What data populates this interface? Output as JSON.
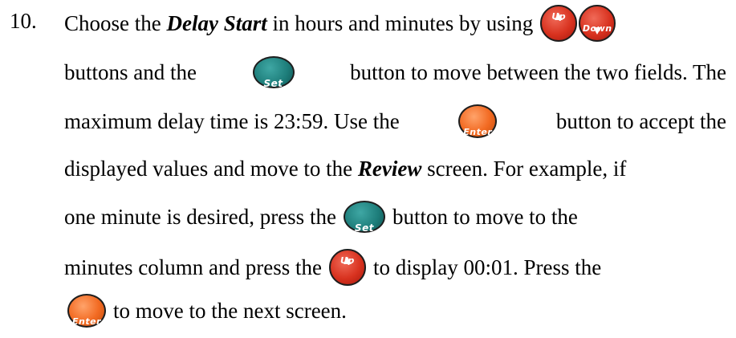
{
  "step": {
    "number": "10."
  },
  "text": {
    "l1_a": "Choose the",
    "l1_term": "Delay Start",
    "l1_b": "in hours and minutes by using",
    "l2_a": "buttons and the",
    "l2_b": "button to move between the two fields. The",
    "l3_a": "maximum delay time is 23:59. Use the",
    "l3_b": "button to accept the",
    "l4_a": "displayed values and move to the",
    "l4_term": "Review",
    "l4_b": "screen. For example, if",
    "l5_a": "one minute is desired, press the",
    "l5_b": "button to move to the",
    "l6_a": "minutes column and press the",
    "l6_b": "to display 00:01. Press the",
    "l7_a": "to move to the next screen."
  },
  "buttons": {
    "up": "Up",
    "down": "Down",
    "set": "Set",
    "enter": "Enter"
  },
  "colors": {
    "up_down": "#d8321f",
    "set": "#1d7d7a",
    "enter": "#f26a22"
  },
  "icons": {
    "up": "up-arrow-key-icon",
    "down": "down-arrow-key-icon",
    "set": "set-key-icon",
    "enter": "enter-key-icon"
  }
}
